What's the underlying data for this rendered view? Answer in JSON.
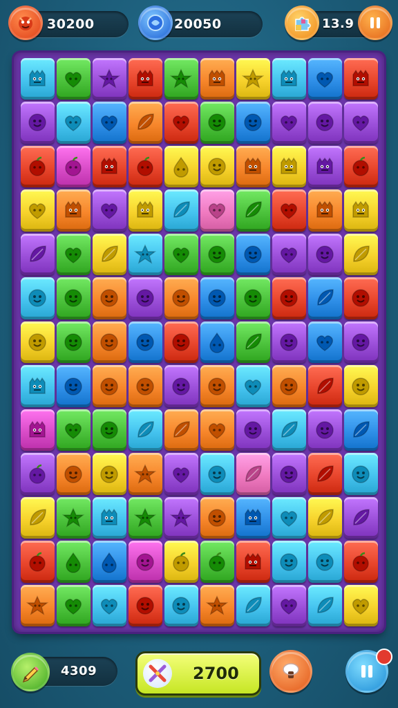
{
  "hud": {
    "score_1": "30200",
    "score_2": "20050",
    "timer": "13.9"
  },
  "footer": {
    "score_left": "4309",
    "score_center": "2700",
    "badge_count": ""
  },
  "colors": {
    "red": "#e8452c",
    "orange": "#f7862b",
    "yellow": "#f7d22c",
    "green": "#4cc23c",
    "lime": "#9bdb2a",
    "blue": "#2f8fe8",
    "sky": "#45c3ef",
    "purple": "#9b4fd9",
    "magenta": "#d94cc8",
    "pink": "#f07ac0"
  },
  "board": {
    "columns": 10,
    "rows": 14,
    "tiles": [
      [
        "sky:monster",
        "green:heart",
        "purple:star",
        "red:monster",
        "green:star",
        "orange:monster",
        "yellow:star",
        "sky:monster",
        "blue:heart",
        "red:monster"
      ],
      [
        "purple:face",
        "sky:heart",
        "blue:heart",
        "orange:leaf",
        "red:heart",
        "green:face",
        "blue:face",
        "purple:heart",
        "purple:face",
        "purple:heart"
      ],
      [
        "red:fruit",
        "magenta:fruit",
        "red:monster",
        "red:fruit",
        "yellow:drop",
        "yellow:face",
        "orange:monster",
        "yellow:monster",
        "purple:monster",
        "red:fruit"
      ],
      [
        "yellow:heart",
        "orange:monster",
        "purple:heart",
        "yellow:monster",
        "sky:leaf",
        "pink:heart",
        "green:leaf",
        "red:heart",
        "orange:monster",
        "yellow:monster"
      ],
      [
        "purple:leaf",
        "green:heart",
        "yellow:leaf",
        "sky:star",
        "green:heart",
        "green:face",
        "blue:face",
        "purple:heart",
        "purple:face",
        "yellow:leaf"
      ],
      [
        "sky:face",
        "green:face",
        "orange:face",
        "purple:face",
        "orange:face",
        "blue:face",
        "green:face",
        "red:face",
        "blue:leaf",
        "red:face"
      ],
      [
        "yellow:face",
        "green:face",
        "orange:face",
        "blue:face",
        "red:face",
        "blue:drop",
        "green:leaf",
        "purple:face",
        "blue:heart",
        "purple:face"
      ],
      [
        "sky:monster",
        "blue:face",
        "orange:face",
        "orange:face",
        "purple:face",
        "orange:face",
        "sky:heart",
        "orange:face",
        "red:leaf",
        "yellow:face"
      ],
      [
        "magenta:monster",
        "green:heart",
        "green:face",
        "sky:leaf",
        "orange:leaf",
        "orange:heart",
        "purple:face",
        "sky:leaf",
        "purple:face",
        "blue:leaf"
      ],
      [
        "purple:fruit",
        "orange:face",
        "yellow:face",
        "orange:star",
        "purple:heart",
        "sky:face",
        "pink:leaf",
        "purple:face",
        "red:leaf",
        "sky:face"
      ],
      [
        "yellow:leaf",
        "green:star",
        "sky:monster",
        "green:star",
        "purple:star",
        "orange:face",
        "blue:monster",
        "sky:heart",
        "yellow:leaf",
        "purple:leaf"
      ],
      [
        "red:fruit",
        "green:drop",
        "blue:drop",
        "magenta:face",
        "yellow:fruit",
        "green:fruit",
        "red:monster",
        "sky:face",
        "sky:face",
        "red:fruit"
      ],
      [
        "orange:star",
        "green:heart",
        "sky:heart",
        "red:face",
        "sky:face",
        "orange:star",
        "sky:leaf",
        "purple:heart",
        "sky:leaf",
        "yellow:heart"
      ]
    ]
  }
}
